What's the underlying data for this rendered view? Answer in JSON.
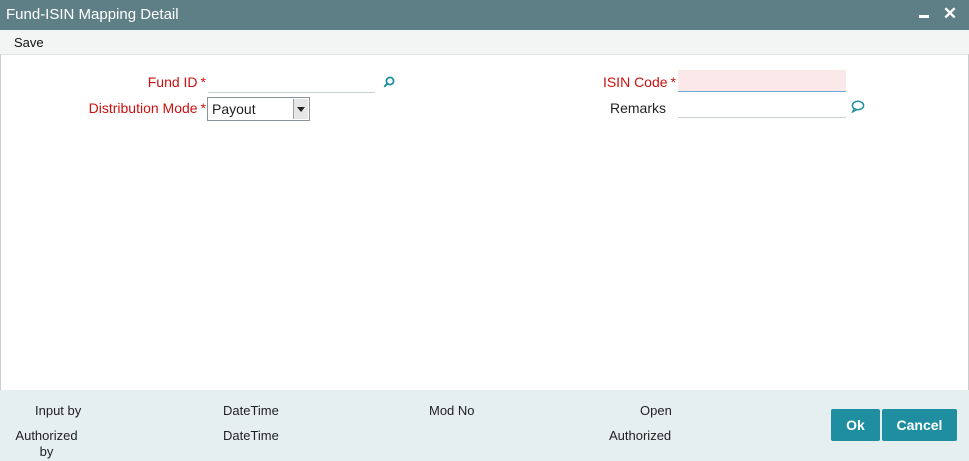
{
  "window": {
    "title": "Fund-ISIN Mapping Detail"
  },
  "menu": {
    "save_label": "Save"
  },
  "form": {
    "fund_id": {
      "label": "Fund ID",
      "required_mark": "*",
      "value": ""
    },
    "distribution_mode": {
      "label": "Distribution Mode",
      "required_mark": "*",
      "value": "Payout"
    },
    "isin_code": {
      "label": "ISIN Code",
      "required_mark": "*",
      "value": ""
    },
    "remarks": {
      "label": "Remarks",
      "value": ""
    }
  },
  "footer": {
    "input_by": "Input by",
    "datetime_1": "DateTime",
    "mod_no": "Mod No",
    "open": "Open",
    "authorized_by_line1": "Authorized",
    "authorized_by_line2": "by",
    "datetime_2": "DateTime",
    "authorized": "Authorized"
  },
  "buttons": {
    "ok": "Ok",
    "cancel": "Cancel"
  },
  "colors": {
    "titlebar": "#5f7f86",
    "button": "#1f8ea0",
    "required": "#cc1010",
    "footer_bg": "#e5eff0"
  },
  "icons": {
    "fund_lookup": "search-icon",
    "remarks_popup": "comment-icon"
  }
}
